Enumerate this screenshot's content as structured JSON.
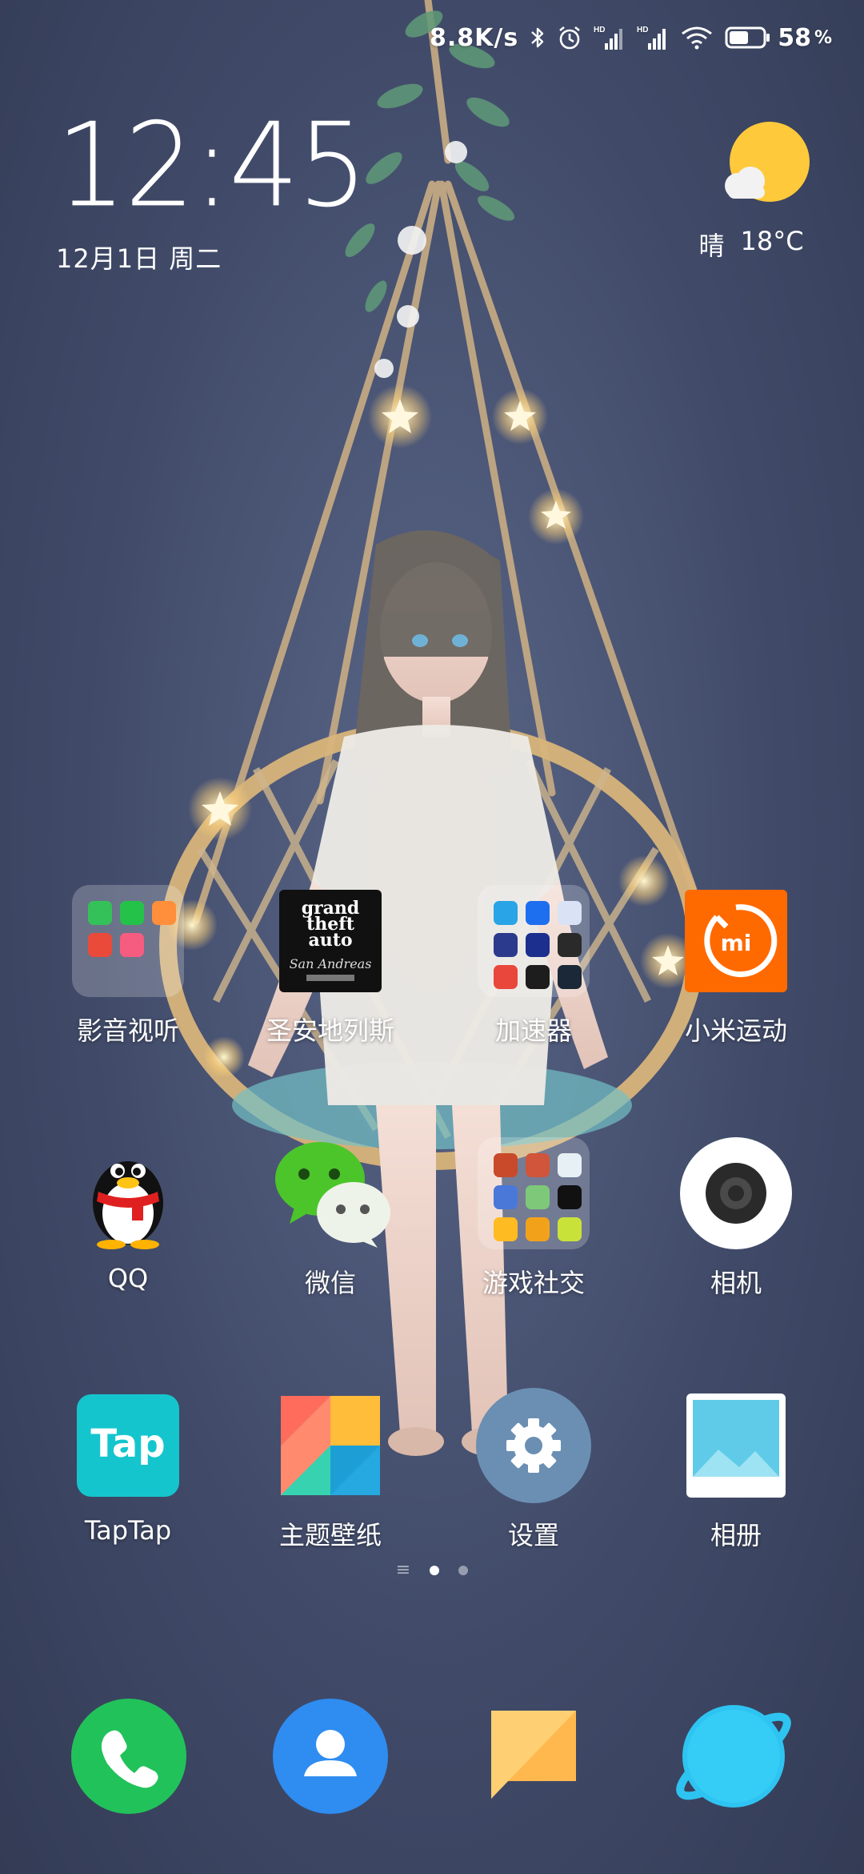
{
  "status_bar": {
    "network_speed": "8.8K/s",
    "battery_level": "58",
    "battery_unit": "%",
    "icons": [
      "bluetooth-icon",
      "alarm-icon",
      "hd-signal-icon",
      "hd-signal-icon",
      "wifi-icon",
      "battery-icon"
    ]
  },
  "clock": {
    "time": "12:45",
    "date": "12月1日 周二"
  },
  "weather": {
    "condition": "晴",
    "temperature": "18°C",
    "icon": "sun-cloud-icon"
  },
  "apps": {
    "row1": [
      {
        "label": "影音视听",
        "icon": "media-folder-icon"
      },
      {
        "label": "圣安地列斯",
        "icon": "gta-san-andreas-icon"
      },
      {
        "label": "加速器",
        "icon": "accelerator-folder-icon"
      },
      {
        "label": "小米运动",
        "icon": "mi-fit-icon"
      }
    ],
    "row2": [
      {
        "label": "QQ",
        "icon": "qq-penguin-icon"
      },
      {
        "label": "微信",
        "icon": "wechat-icon"
      },
      {
        "label": "游戏社交",
        "icon": "games-folder-icon"
      },
      {
        "label": "相机",
        "icon": "camera-icon"
      }
    ],
    "row3": [
      {
        "label": "TapTap",
        "icon": "taptap-icon"
      },
      {
        "label": "主题壁纸",
        "icon": "themes-icon"
      },
      {
        "label": "设置",
        "icon": "settings-gear-icon"
      },
      {
        "label": "相册",
        "icon": "gallery-icon"
      }
    ]
  },
  "gta_logo": {
    "line1": "grand",
    "line2": "theft",
    "line3": "auto",
    "line4": "San Andreas"
  },
  "taptap_logo": "Tap",
  "mi_logo": "mi",
  "dock": [
    {
      "icon": "phone-icon"
    },
    {
      "icon": "contacts-icon"
    },
    {
      "icon": "messages-icon"
    },
    {
      "icon": "browser-icon"
    }
  ],
  "page_indicator": {
    "pages": 2,
    "active": 1
  },
  "colors": {
    "phone": "#22c25a",
    "contacts": "#2f8cf0",
    "messages": "#ffb84d",
    "browser": "#2ec4f2",
    "mi_fit": "#ff6a00",
    "taptap": "#15c5ce",
    "settings": "#6b8fb3"
  }
}
